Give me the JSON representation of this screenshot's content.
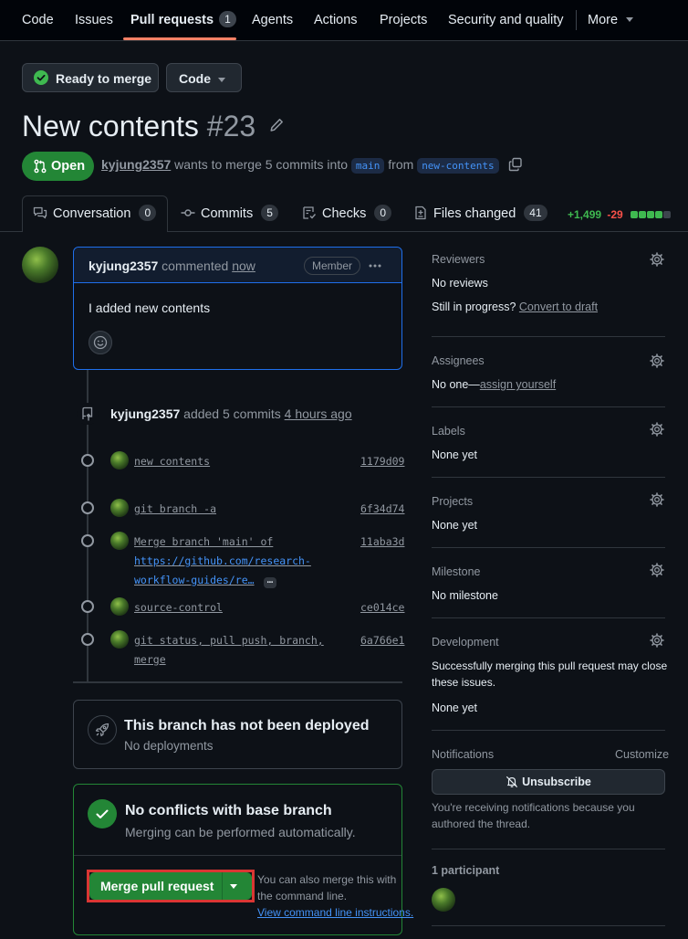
{
  "nav": {
    "items": [
      "Code",
      "Issues",
      "Pull requests",
      "Agents",
      "Actions",
      "Projects",
      "Security and quality",
      "More"
    ],
    "pr_count": "1"
  },
  "actions": {
    "ready": "Ready to merge",
    "code": "Code"
  },
  "pr": {
    "title": "New contents",
    "number": "#23",
    "state": "Open",
    "author": "kyjung2357",
    "meta_text": "wants to merge 5 commits into",
    "base": "main",
    "from_text": "from",
    "head": "new-contents"
  },
  "tabs": [
    {
      "label": "Conversation",
      "count": "0"
    },
    {
      "label": "Commits",
      "count": "5"
    },
    {
      "label": "Checks",
      "count": "0"
    },
    {
      "label": "Files changed",
      "count": "41"
    }
  ],
  "diffstat": {
    "add": "+1,499",
    "del": "-29"
  },
  "comment": {
    "author": "kyjung2357",
    "action": "commented",
    "time": "now",
    "role": "Member",
    "body": "I added new contents"
  },
  "commits_event": {
    "author": "kyjung2357",
    "text": "added 5 commits",
    "time": "4 hours ago"
  },
  "commits": [
    {
      "msg": [
        "new contents"
      ],
      "sha": "1179d09"
    },
    {
      "msg": [
        "git branch -a"
      ],
      "sha": "6f34d74"
    },
    {
      "msg": [
        "Merge branch 'main' of",
        "https://github.com/research-",
        "workflow-guides/re…"
      ],
      "sha": "11aba3d"
    },
    {
      "msg": [
        "source-control"
      ],
      "sha": "ce014ce"
    },
    {
      "msg": [
        "git status, pull push, branch,",
        "merge"
      ],
      "sha": "6a766e1"
    }
  ],
  "deploy": {
    "title": "This branch has not been deployed",
    "sub": "No deployments"
  },
  "merge": {
    "title": "No conflicts with base branch",
    "sub": "Merging can be performed automatically.",
    "button": "Merge pull request",
    "hint1": "You can also merge this with",
    "hint2": "the command line.",
    "hint_link": "View command line instructions."
  },
  "sidebar": {
    "reviewers": {
      "heading": "Reviewers",
      "value": "No reviews",
      "progress": "Still in progress?",
      "progress_link": "Convert to draft"
    },
    "assignees": {
      "heading": "Assignees",
      "value": "No one—",
      "link": "assign yourself"
    },
    "labels": {
      "heading": "Labels",
      "value": "None yet"
    },
    "projects": {
      "heading": "Projects",
      "value": "None yet"
    },
    "milestone": {
      "heading": "Milestone",
      "value": "No milestone"
    },
    "development": {
      "heading": "Development",
      "text1": "Successfully merging this pull request may close",
      "text2": "these issues.",
      "value": "None yet"
    },
    "notifications": {
      "heading": "Notifications",
      "customize": "Customize",
      "button": "Unsubscribe",
      "text1": "You're receiving notifications because you",
      "text2": "authored the thread."
    },
    "participants": {
      "heading": "1 participant"
    }
  },
  "colors": {
    "green": "#238636",
    "blue": "#4493f8",
    "add": "#3fb950",
    "del": "#f85149",
    "highlight": "#da3633"
  }
}
